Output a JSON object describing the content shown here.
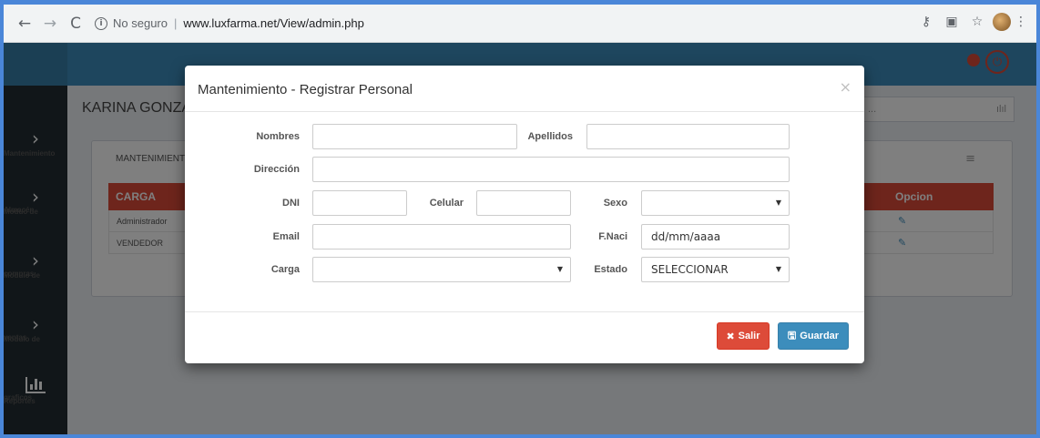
{
  "browser": {
    "back": "←",
    "forward": "→",
    "reload": "C",
    "security_text": "No seguro",
    "url": "www.luxfarma.net/View/admin.php"
  },
  "app": {
    "page_title": "KARINA GONZAL",
    "search_placeholder": "...",
    "search_icon": "ılıl"
  },
  "sidebar": {
    "items": [
      {
        "label_1": "Mantenimiento",
        "label_2": ""
      },
      {
        "label_1": "Moduo de",
        "label_2": "Almacén"
      },
      {
        "label_1": "Modulo de",
        "label_2": "compras"
      },
      {
        "label_1": "Modulo de",
        "label_2": "ventas"
      }
    ],
    "reports": {
      "label_1": "Reportes",
      "label_2": "graficos"
    }
  },
  "panel": {
    "tab_label": "MANTENIMIENTO",
    "columns": [
      "CARGA",
      "Opcion"
    ],
    "rows": [
      {
        "carga": "Administrador"
      },
      {
        "carga": "VENDEDOR"
      }
    ]
  },
  "modal": {
    "title": "Mantenimiento - Registrar Personal",
    "close": "×",
    "labels": {
      "nombres": "Nombres",
      "apellidos": "Apellidos",
      "direccion": "Dirección",
      "dni": "DNI",
      "celular": "Celular",
      "sexo": "Sexo",
      "email": "Email",
      "fnaci": "F.Naci",
      "carga": "Carga",
      "estado": "Estado"
    },
    "values": {
      "nombres": "",
      "apellidos": "",
      "direccion": "",
      "dni": "",
      "celular": "",
      "sexo": "",
      "email": "",
      "fnaci": "dd/mm/aaaa",
      "carga": "",
      "estado": "SELECCIONAR"
    },
    "buttons": {
      "salir": "Salir",
      "guardar": "Guardar"
    }
  },
  "colors": {
    "primary": "#3c8dbc",
    "danger": "#dd4b39",
    "sidebar": "#222d32"
  }
}
